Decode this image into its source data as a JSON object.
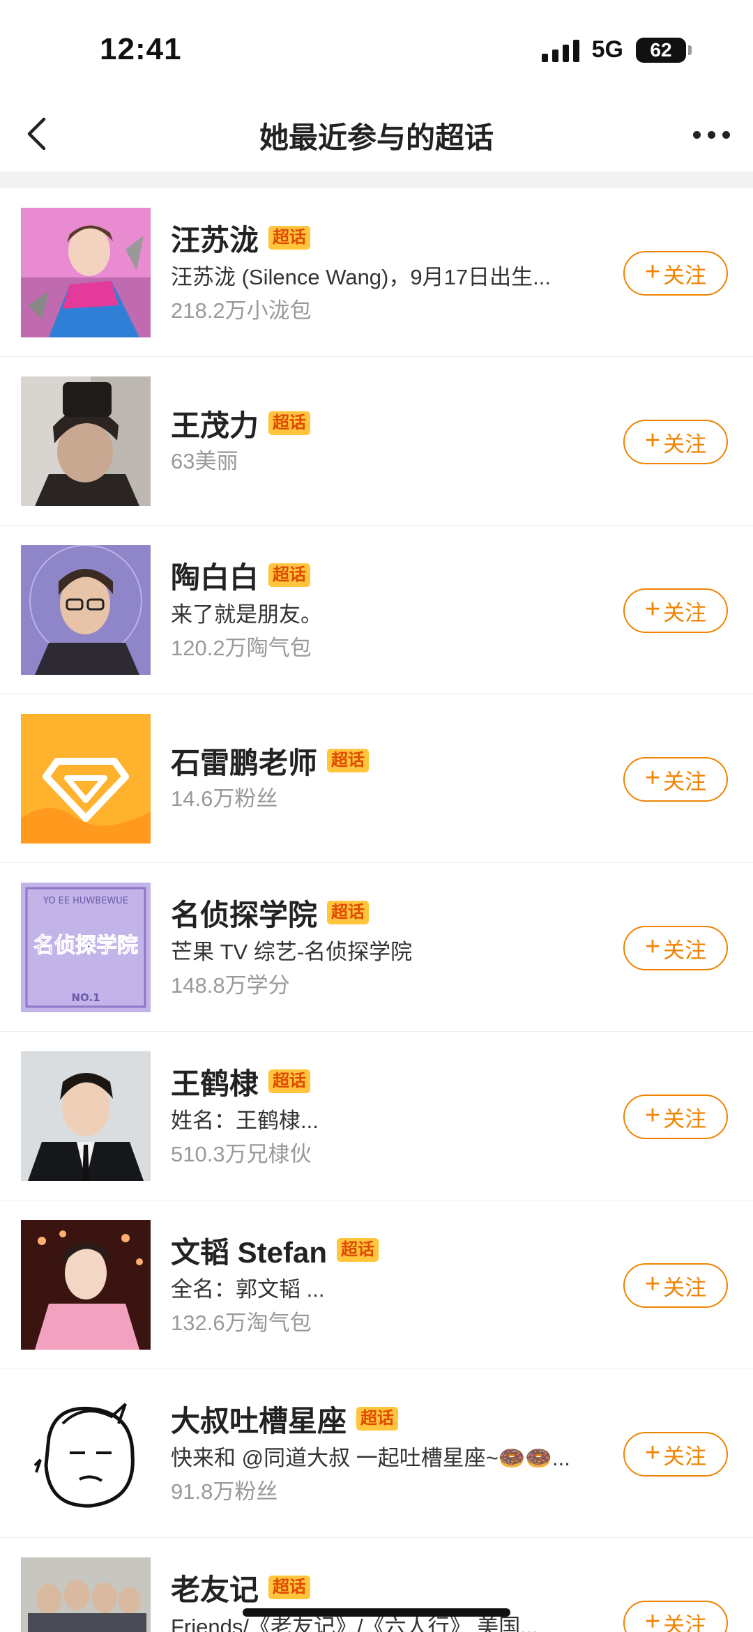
{
  "status_bar": {
    "time": "12:41",
    "network": "5G",
    "battery": "62"
  },
  "nav": {
    "title": "她最近参与的超话"
  },
  "badge_label": "超话",
  "follow_label": "关注",
  "follow_plus": "+",
  "items": [
    {
      "title": "汪苏泷",
      "desc": "汪苏泷 (Silence Wang)，9月17日出生...",
      "count": "218.2万小泷包"
    },
    {
      "title": "王茂力",
      "desc": "",
      "count": "63美丽"
    },
    {
      "title": "陶白白",
      "desc": "来了就是朋友。",
      "count": "120.2万陶气包"
    },
    {
      "title": "石雷鹏老师",
      "desc": "",
      "count": "14.6万粉丝"
    },
    {
      "title": "名侦探学院",
      "desc": "芒果 TV 综艺-名侦探学院",
      "count": "148.8万学分"
    },
    {
      "title": "王鹤棣",
      "desc": "姓名：王鹤棣...",
      "count": "510.3万兄棣伙"
    },
    {
      "title": "文韬 Stefan",
      "desc": "全名：郭文韬 ...",
      "count": "132.6万淘气包"
    },
    {
      "title": "大叔吐槽星座",
      "desc": "快来和 @同道大叔 一起吐槽星座~🍩🍩...",
      "count": "91.8万粉丝"
    },
    {
      "title": "老友记",
      "desc": "Friends/《老友记》/《六人行》 美国...",
      "count": ""
    }
  ],
  "thumb_texts": {
    "academy_top": "YO EE HUWBEWUE",
    "academy_main": "名侦探学院",
    "academy_bottom": "NO.1"
  }
}
